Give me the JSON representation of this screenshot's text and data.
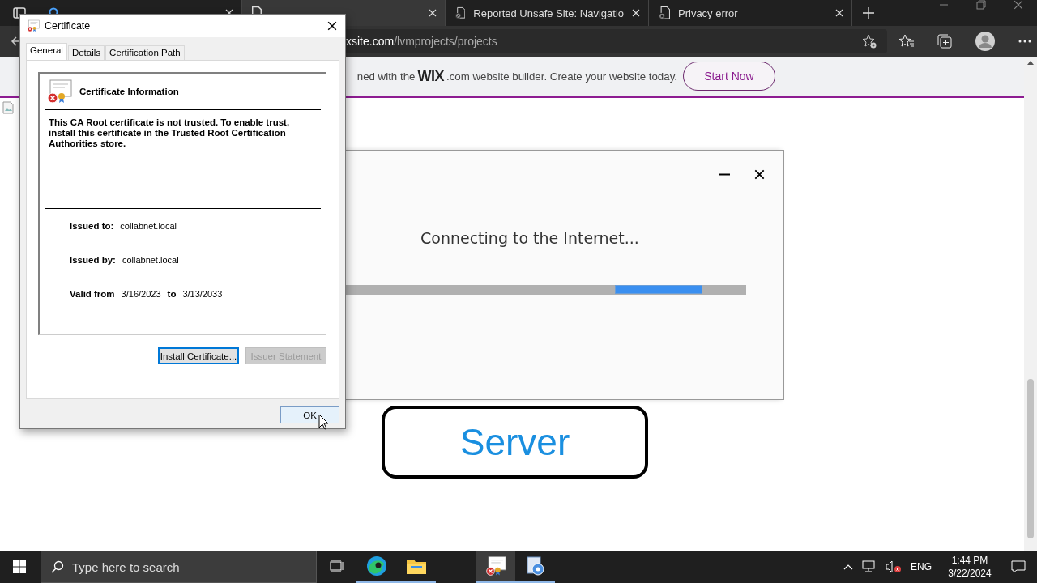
{
  "browser": {
    "tabs": [
      {
        "kind": "search",
        "selected": false
      },
      {
        "kind": "page",
        "selected": true
      },
      {
        "title": "Reported Unsafe Site: Navigatio",
        "kind": "warning",
        "selected": false
      },
      {
        "title": "Privacy error",
        "kind": "warning",
        "selected": false
      }
    ],
    "address": "**xsite.com**/lvmprojects/projects",
    "banner": {
      "text_before": "ned with the",
      "logo": "WIX",
      "text_after": ".com website builder. Create your website today.",
      "button": "Start Now"
    }
  },
  "connecting_window": {
    "message": "Connecting to the Internet...",
    "indeterminate": true
  },
  "server_label": "Server",
  "certificate_dialog": {
    "title": "Certificate",
    "tabs": [
      {
        "label": "General",
        "selected": true
      },
      {
        "label": "Details",
        "selected": false
      },
      {
        "label": "Certification Path",
        "selected": false
      }
    ],
    "heading": "Certificate Information",
    "message": "This CA Root certificate is not trusted. To enable trust, install this certificate in the Trusted Root Certification Authorities store.",
    "fields": [
      {
        "label": "Issued to:",
        "value": "collabnet.local"
      },
      {
        "label": "Issued by:",
        "value": "collabnet.local"
      }
    ],
    "validity": {
      "from_label": "Valid from",
      "from": "3/16/2023",
      "to_label": "to",
      "to": "3/13/2033"
    },
    "buttons": [
      {
        "label": "Install Certificate...",
        "disabled": false
      },
      {
        "label": "Issuer Statement",
        "disabled": true
      }
    ],
    "ok": "OK"
  },
  "taskbar": {
    "search_placeholder": "Type here to search",
    "apps": [
      {
        "kind": "task-view",
        "active": false
      },
      {
        "kind": "edge",
        "active": false
      },
      {
        "kind": "explorer",
        "active": false
      },
      {
        "kind": "spacer",
        "active": false
      },
      {
        "kind": "certificate",
        "active": true
      },
      {
        "kind": "installer",
        "active": false
      }
    ],
    "language": "ENG",
    "time": "1:44 PM",
    "date": "3/22/2024"
  }
}
